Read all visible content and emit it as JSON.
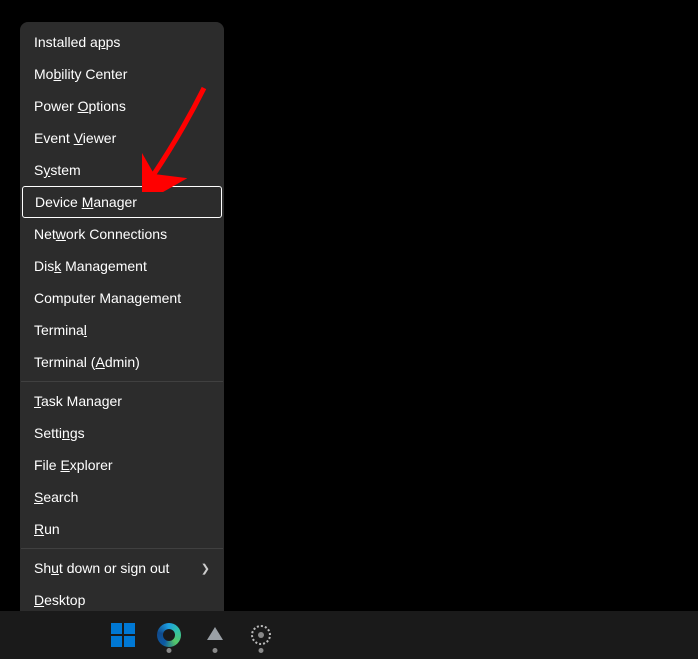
{
  "menu": {
    "groups": [
      [
        {
          "label": "Installed a_pps",
          "name": "menu-installed-apps",
          "hl": false,
          "sub": false
        },
        {
          "label": "Mo_bility Center",
          "name": "menu-mobility-center",
          "hl": false,
          "sub": false
        },
        {
          "label": "Power _Options",
          "name": "menu-power-options",
          "hl": false,
          "sub": false
        },
        {
          "label": "Event _Viewer",
          "name": "menu-event-viewer",
          "hl": false,
          "sub": false
        },
        {
          "label": "S_ystem",
          "name": "menu-system",
          "hl": false,
          "sub": false
        },
        {
          "label": "Device _Manager",
          "name": "menu-device-manager",
          "hl": true,
          "sub": false
        },
        {
          "label": "Net_work Connections",
          "name": "menu-network-connections",
          "hl": false,
          "sub": false
        },
        {
          "label": "Dis_k Management",
          "name": "menu-disk-management",
          "hl": false,
          "sub": false
        },
        {
          "label": "Computer Mana_gement",
          "name": "menu-computer-management",
          "hl": false,
          "sub": false
        },
        {
          "label": "Termina_l",
          "name": "menu-terminal",
          "hl": false,
          "sub": false
        },
        {
          "label": "Terminal (_Admin)",
          "name": "menu-terminal-admin",
          "hl": false,
          "sub": false
        }
      ],
      [
        {
          "label": "_Task Manager",
          "name": "menu-task-manager",
          "hl": false,
          "sub": false
        },
        {
          "label": "Setti_ngs",
          "name": "menu-settings",
          "hl": false,
          "sub": false
        },
        {
          "label": "File _Explorer",
          "name": "menu-file-explorer",
          "hl": false,
          "sub": false
        },
        {
          "label": "_Search",
          "name": "menu-search",
          "hl": false,
          "sub": false
        },
        {
          "label": "_Run",
          "name": "menu-run",
          "hl": false,
          "sub": false
        }
      ],
      [
        {
          "label": "Sh_ut down or sign out",
          "name": "menu-shutdown-signout",
          "hl": false,
          "sub": true
        },
        {
          "label": "_Desktop",
          "name": "menu-desktop",
          "hl": false,
          "sub": false
        }
      ]
    ]
  },
  "taskbar": {
    "buttons": [
      {
        "name": "start-button",
        "icon": "start-icon"
      },
      {
        "name": "edge-button",
        "icon": "edge-icon"
      },
      {
        "name": "app-button-1",
        "icon": "generic-app-icon"
      },
      {
        "name": "settings-button",
        "icon": "gear-icon"
      }
    ]
  },
  "annotation": {
    "arrow_color": "#ff0000"
  }
}
